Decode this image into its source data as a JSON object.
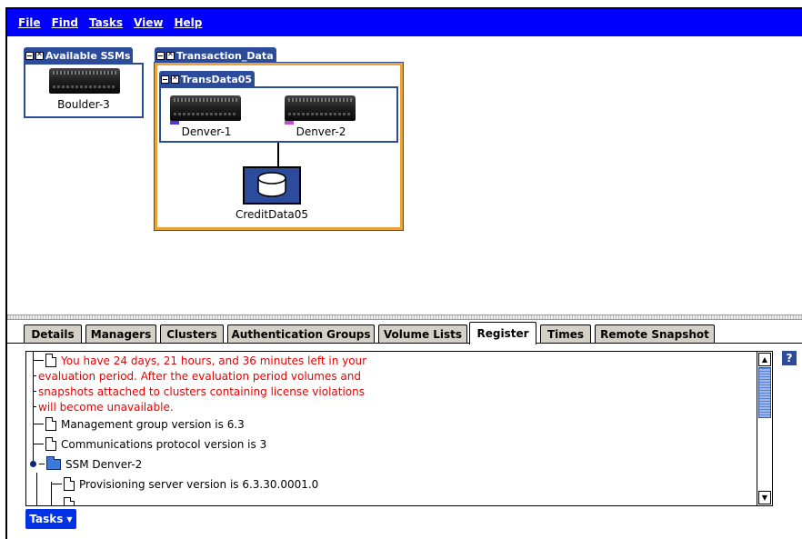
{
  "menubar": {
    "items": [
      {
        "label": "File"
      },
      {
        "label": "Find"
      },
      {
        "label": "Tasks"
      },
      {
        "label": "View"
      },
      {
        "label": "Help"
      }
    ]
  },
  "canvas": {
    "available_group": {
      "title": "Available SSMs",
      "devices": [
        {
          "label": "Boulder-3"
        }
      ]
    },
    "transaction_group": {
      "title": "Transaction_Data",
      "cluster": {
        "title": "TransData05",
        "devices": [
          {
            "label": "Denver-1"
          },
          {
            "label": "Denver-2"
          }
        ]
      },
      "volume": {
        "label": "CreditData05"
      }
    }
  },
  "tabs": [
    {
      "label": "Details"
    },
    {
      "label": "Managers"
    },
    {
      "label": "Clusters"
    },
    {
      "label": "Authentication Groups"
    },
    {
      "label": "Volume Lists"
    },
    {
      "label": "Register",
      "active": true
    },
    {
      "label": "Times"
    },
    {
      "label": "Remote Snapshot"
    }
  ],
  "register": {
    "warning_lines": [
      "You have 24 days, 21 hours, and 36 minutes left in your",
      "evaluation period. After the evaluation period volumes and",
      "snapshots attached to clusters containing license violations",
      "will become unavailable."
    ],
    "items": [
      {
        "text": "Management group version is 6.3"
      },
      {
        "text": "Communications protocol version is 3"
      }
    ],
    "ssm_node": {
      "label": "SSM Denver-2",
      "children": [
        {
          "text": "Provisioning server version is 6.3.30.0001.0"
        }
      ]
    }
  },
  "help_button": {
    "label": "?"
  },
  "tasks_button": {
    "label": "Tasks",
    "arrow": "▼"
  },
  "colors": {
    "menubar": "#0000ff",
    "group_header": "#2c4b9a",
    "selected_border": "#e8a33a",
    "warning_text": "#e80000",
    "tasks_button": "#0033e6"
  }
}
